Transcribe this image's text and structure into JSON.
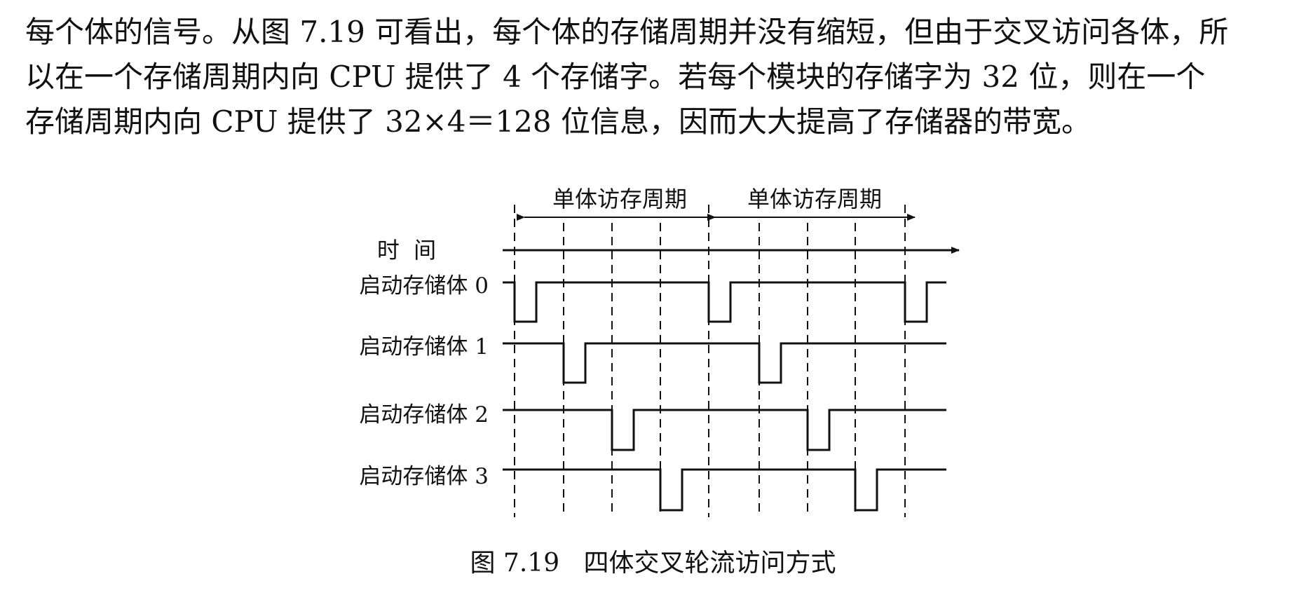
{
  "paragraph": {
    "lines": [
      "每个体的信号。从图 7.19 可看出，每个体的存储周期并没有缩短，但由于交叉访问各体，所",
      "以在一个存储周期内向 CPU 提供了 4 个存储字。若每个模块的存储字为 32 位，则在一个",
      "存储周期内向 CPU 提供了 32×4＝128 位信息，因而大大提高了存储器的带宽。"
    ]
  },
  "figure": {
    "caption": "图 7.19   四体交叉轮流访问方式",
    "time_label": "时  间",
    "period_labels": [
      "单体访存周期",
      "单体访存周期"
    ],
    "row_labels": [
      "启动存储体 0",
      "启动存储体 1",
      "启动存储体 2",
      "启动存储体 3"
    ],
    "bank_pulse_slots": [
      [
        0,
        4,
        8
      ],
      [
        1,
        5
      ],
      [
        2,
        6
      ],
      [
        3,
        7
      ]
    ],
    "colors": {
      "line": "#111111",
      "text": "#111111"
    }
  }
}
